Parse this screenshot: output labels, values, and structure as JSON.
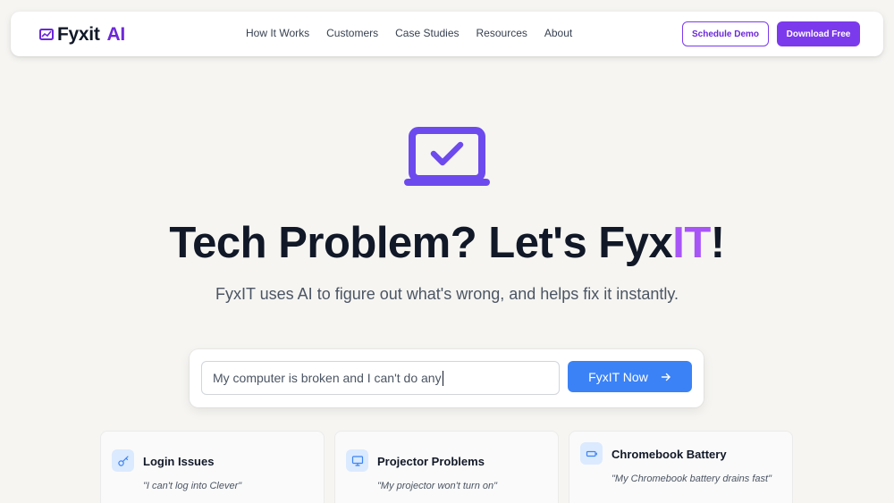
{
  "brand": {
    "name": "Fyxit",
    "accent": "AI"
  },
  "nav": {
    "links": [
      "How It Works",
      "Customers",
      "Case Studies",
      "Resources",
      "About"
    ],
    "schedule_demo": "Schedule Demo",
    "download": "Download Free"
  },
  "hero": {
    "title_main": "Tech Problem? Let's Fyx",
    "title_accent": "IT",
    "title_end": "!",
    "subtitle": "FyxIT uses AI to figure out what's wrong, and helps fix it instantly."
  },
  "search": {
    "value": "My computer is broken and I can't do any",
    "button": "FyxIT Now",
    "button_icon": "arrow-right-icon"
  },
  "cards": [
    {
      "title": "Login Issues",
      "quote": "\"I can't log into Clever\"",
      "icon": "key-icon"
    },
    {
      "title": "Projector Problems",
      "quote": "\"My projector won't turn on\"",
      "icon": "monitor-icon"
    },
    {
      "title": "Chromebook Battery",
      "quote": "\"My Chromebook battery drains fast\"",
      "icon": "battery-icon"
    }
  ],
  "colors": {
    "primary": "#7c3aed",
    "accent_text": "#a855f7",
    "button_blue": "#3b82f6",
    "background": "#f6f5f2"
  }
}
